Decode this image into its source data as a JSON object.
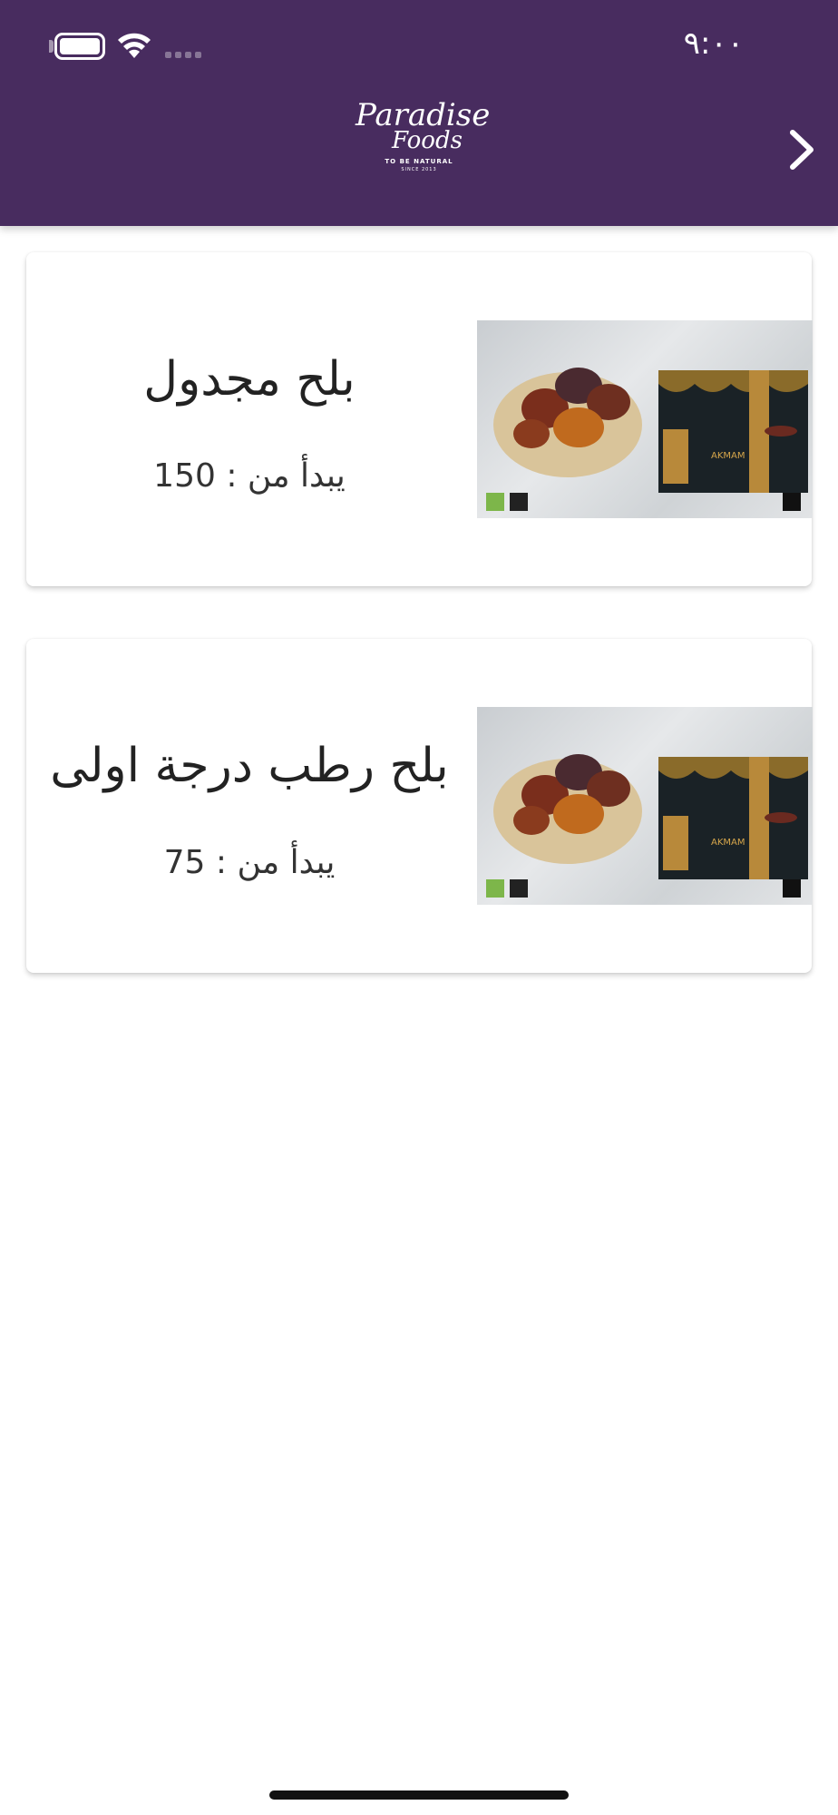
{
  "status_bar": {
    "time": "٩:٠٠"
  },
  "header": {
    "logo_line1": "Paradise",
    "logo_line2": "Foods",
    "logo_tagline": "TO BE NATURAL",
    "logo_since": "SINCE 2013",
    "back_icon": "chevron-right-icon"
  },
  "products": [
    {
      "title": "بلح مجدول",
      "price_text": "يبدأ من : 150",
      "image_label": "AKMAM"
    },
    {
      "title": "بلح رطب درجة اولى",
      "price_text": "يبدأ من : 75",
      "image_label": "AKMAM"
    }
  ],
  "colors": {
    "header": "#482c5f",
    "background": "#ffffff",
    "text": "#222222"
  }
}
